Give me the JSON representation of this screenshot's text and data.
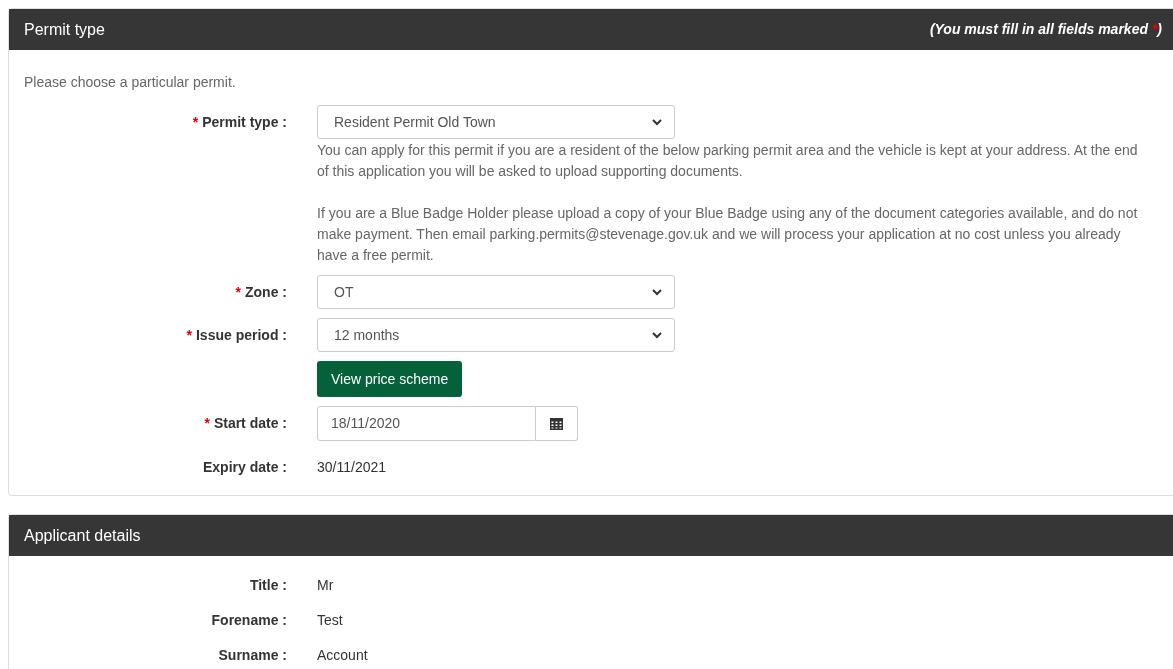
{
  "panels": [
    {
      "title": "Permit type",
      "note": {
        "text": "(You must fill in all fields marked ",
        "mark": "*",
        "end": ")"
      },
      "intro": "Please choose a particular permit.",
      "fields": [
        {
          "kind": "select",
          "marker": "*",
          "label": "Permit type :",
          "value": "Resident Permit Old Town",
          "help": [
            "You can apply for this permit if you are a resident of the below parking permit area and the vehicle is kept at your address. At the end of this application you will be asked to upload supporting documents.",
            "If you are a Blue Badge Holder please upload a copy of your Blue Badge using any of the document categories available, and do not make payment. Then email parking.permits@stevenage.gov.uk and we will process your application at no cost unless you already have a free permit."
          ]
        },
        {
          "kind": "select",
          "marker": "*",
          "label": "Zone :",
          "value": "OT"
        },
        {
          "kind": "select",
          "marker": "*",
          "label": "Issue period :",
          "value": "12 months"
        },
        {
          "kind": "button",
          "label": "View price scheme"
        },
        {
          "kind": "date",
          "marker": "*",
          "label": "Start date :",
          "value": "18/11/2020"
        },
        {
          "kind": "static",
          "label": "Expiry date :",
          "value": "30/11/2021"
        }
      ]
    },
    {
      "title": "Applicant details",
      "fields": [
        {
          "kind": "static",
          "label": "Title :",
          "value": "Mr"
        },
        {
          "kind": "static",
          "label": "Forename :",
          "value": "Test"
        },
        {
          "kind": "static",
          "label": "Surname :",
          "value": "Account"
        }
      ]
    }
  ]
}
